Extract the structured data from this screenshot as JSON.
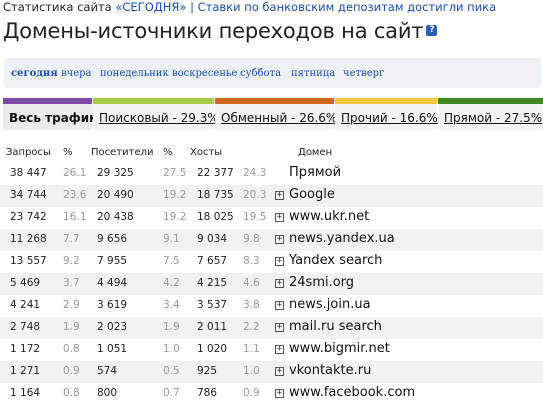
{
  "breadcrumb": {
    "prefix": "Статистика сайта",
    "period_link": "«СЕГОДНЯ»",
    "separator": "|",
    "news_link": "Ставки по банковским депозитам достигли пика"
  },
  "page": {
    "title": "Домены-источники переходов на сайт",
    "help_icon": "?"
  },
  "periods": [
    {
      "label": "сегодня",
      "active": true
    },
    {
      "label": "вчера"
    },
    {
      "label": "понедельник"
    },
    {
      "label": "воскресенье"
    },
    {
      "label": "суббота"
    },
    {
      "label": "пятница"
    },
    {
      "label": "четверг"
    }
  ],
  "source_tabs": [
    {
      "label": "Весь трафик",
      "color": "#7b4aa8",
      "active": true
    },
    {
      "label": "Поисковый - 29.3%",
      "color": "#a6cc4a"
    },
    {
      "label": "Обменный - 26.6%",
      "color": "#cc6a1a"
    },
    {
      "label": "Прочий - 16.6%",
      "color": "#f5c842"
    },
    {
      "label": "Прямой - 27.5%",
      "color": "#3c8a1e"
    }
  ],
  "table": {
    "headers": {
      "requests": "Запросы",
      "requests_pct": "%",
      "visitors": "Посетители",
      "visitors_pct": "%",
      "hosts": "Хосты",
      "domain": "Домен"
    },
    "rows": [
      {
        "requests": "38 447",
        "rp": "26.1",
        "visitors": "29 325",
        "vp": "27.5",
        "hosts": "22 377",
        "hp": "24.3",
        "domain": "Прямой",
        "expandable": false
      },
      {
        "requests": "34 744",
        "rp": "23.6",
        "visitors": "20 490",
        "vp": "19.2",
        "hosts": "18 735",
        "hp": "20.3",
        "domain": "Google",
        "expandable": true
      },
      {
        "requests": "23 742",
        "rp": "16.1",
        "visitors": "20 438",
        "vp": "19.2",
        "hosts": "18 025",
        "hp": "19.5",
        "domain": "www.ukr.net",
        "expandable": true
      },
      {
        "requests": "11 268",
        "rp": "7.7",
        "visitors": "9 656",
        "vp": "9.1",
        "hosts": "9 034",
        "hp": "9.8",
        "domain": "news.yandex.ua",
        "expandable": true
      },
      {
        "requests": "13 557",
        "rp": "9.2",
        "visitors": "7 955",
        "vp": "7.5",
        "hosts": "7 657",
        "hp": "8.3",
        "domain": "Yandex search",
        "expandable": true
      },
      {
        "requests": "5 469",
        "rp": "3.7",
        "visitors": "4 494",
        "vp": "4.2",
        "hosts": "4 215",
        "hp": "4.6",
        "domain": "24smi.org",
        "expandable": true
      },
      {
        "requests": "4 241",
        "rp": "2.9",
        "visitors": "3 619",
        "vp": "3.4",
        "hosts": "3 537",
        "hp": "3.8",
        "domain": "news.join.ua",
        "expandable": true
      },
      {
        "requests": "2 748",
        "rp": "1.9",
        "visitors": "2 023",
        "vp": "1.9",
        "hosts": "2 011",
        "hp": "2.2",
        "domain": "mail.ru search",
        "expandable": true
      },
      {
        "requests": "1 172",
        "rp": "0.8",
        "visitors": "1 051",
        "vp": "1.0",
        "hosts": "1 020",
        "hp": "1.1",
        "domain": "www.bigmir.net",
        "expandable": true
      },
      {
        "requests": "1 271",
        "rp": "0.9",
        "visitors": "574",
        "vp": "0.5",
        "hosts": "925",
        "hp": "1.0",
        "domain": "vkontakte.ru",
        "expandable": true
      },
      {
        "requests": "1 164",
        "rp": "0.8",
        "visitors": "800",
        "vp": "0.7",
        "hosts": "786",
        "hp": "0.9",
        "domain": "www.facebook.com",
        "expandable": true
      }
    ]
  }
}
